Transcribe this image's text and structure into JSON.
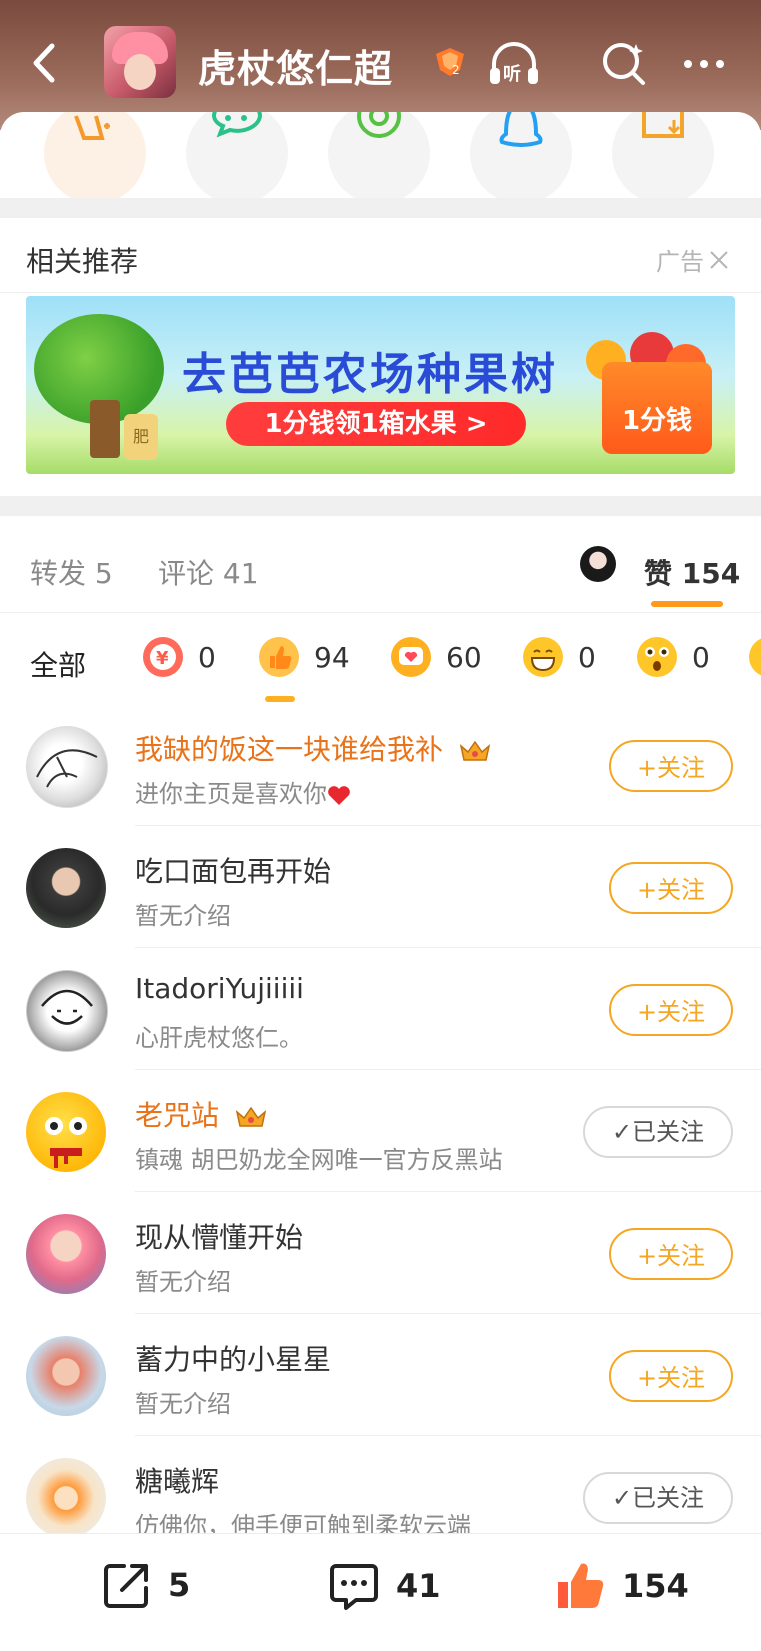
{
  "header": {
    "title": "虎杖悠仁超",
    "badge_level": "2",
    "listen_label": "听"
  },
  "share_icons": [
    {
      "name": "edit-post-icon",
      "color": "#f39a2a"
    },
    {
      "name": "wechat-icon",
      "color": "#2ac28a"
    },
    {
      "name": "moments-icon",
      "color": "#55c243"
    },
    {
      "name": "qq-icon",
      "color": "#24a0f2"
    },
    {
      "name": "save-image-icon",
      "color": "#f3a52a"
    }
  ],
  "related": {
    "title": "相关推荐",
    "ad_label": "广告"
  },
  "banner": {
    "title": "去芭芭农场种果树",
    "cta": "1分钱领1箱水果 >",
    "box_label": "1分钱",
    "bag_label": "肥"
  },
  "tabs": {
    "repost_label": "转发",
    "repost_count": "5",
    "comment_label": "评论",
    "comment_count": "41",
    "like_label": "赞",
    "like_count": "154"
  },
  "reactions": {
    "all_label": "全部",
    "items": [
      {
        "name": "reward-icon",
        "count": "0",
        "color": "#ff5a4a"
      },
      {
        "name": "thumbs-up-icon",
        "count": "94",
        "color": "#ff9a1a"
      },
      {
        "name": "heart-icon",
        "count": "60",
        "color": "#ffb020"
      },
      {
        "name": "laugh-icon",
        "count": "0",
        "color": "#ffc62a"
      },
      {
        "name": "surprised-icon",
        "count": "0",
        "color": "#ffc62a"
      }
    ]
  },
  "users": [
    {
      "name": "我缺的饭这一块谁给我补",
      "desc": "进你主页是喜欢你",
      "vip": true,
      "crown": true,
      "heart": true,
      "followed": false
    },
    {
      "name": "吃口面包再开始",
      "desc": "暂无介绍",
      "vip": false,
      "crown": false,
      "heart": false,
      "followed": false
    },
    {
      "name": "ItadoriYujiiiii",
      "desc": "心肝虎杖悠仁。",
      "vip": false,
      "crown": false,
      "heart": false,
      "followed": false
    },
    {
      "name": "老咒站",
      "desc": "镇魂 胡巴奶龙全网唯一官方反黑站",
      "vip": true,
      "crown": true,
      "heart": false,
      "followed": true
    },
    {
      "name": "现从懵懂开始",
      "desc": "暂无介绍",
      "vip": false,
      "crown": false,
      "heart": false,
      "followed": false
    },
    {
      "name": "蓄力中的小星星",
      "desc": "暂无介绍",
      "vip": false,
      "crown": false,
      "heart": false,
      "followed": false
    },
    {
      "name": "糖曦辉",
      "desc": "仿佛你，伸手便可触到柔软云端",
      "vip": false,
      "crown": false,
      "heart": false,
      "followed": true
    }
  ],
  "buttons": {
    "follow_label": "+关注",
    "followed_label": "✓已关注"
  },
  "bottom_bar": {
    "repost_count": "5",
    "comment_count": "41",
    "like_count": "154"
  },
  "colors": {
    "accent": "#f5a623",
    "vip_name": "#e8731a",
    "like_red": "#ff5a3a"
  }
}
